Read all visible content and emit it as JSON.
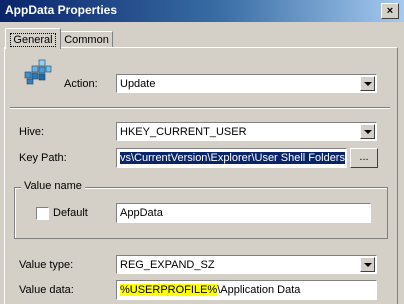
{
  "window": {
    "title": "AppData Properties",
    "close": "×"
  },
  "tabs": [
    {
      "label": "General"
    },
    {
      "label": "Common"
    }
  ],
  "action": {
    "label": "Action:",
    "value": "Update"
  },
  "hive": {
    "label": "Hive:",
    "value": "HKEY_CURRENT_USER"
  },
  "key_path": {
    "label": "Key Path:",
    "value": "vs\\CurrentVersion\\Explorer\\User Shell Folders",
    "browse_label": "..."
  },
  "value_name": {
    "group_title": "Value name",
    "default_label": "Default",
    "value": "AppData"
  },
  "value_type": {
    "label": "Value type:",
    "value": "REG_EXPAND_SZ"
  },
  "value_data": {
    "label": "Value data:",
    "highlight": "%USERPROFILE%",
    "rest": "\\Application Data"
  }
}
